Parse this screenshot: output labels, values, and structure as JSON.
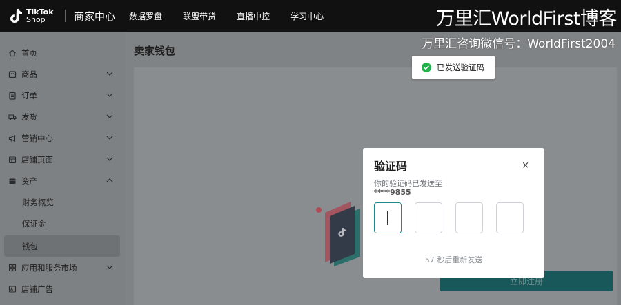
{
  "topbar": {
    "logo_line1": "TikTok",
    "logo_line2": "Shop",
    "brand": "商家中心",
    "nav": [
      "数据罗盘",
      "联盟带货",
      "直播中控",
      "学习中心"
    ]
  },
  "watermark": {
    "line1": "万里汇WorldFirst博客",
    "line2": "万里汇咨询微信号：WorldFirst2004"
  },
  "sidebar": {
    "items": [
      {
        "label": "首页",
        "icon": "home-icon"
      },
      {
        "label": "商品",
        "icon": "product-icon"
      },
      {
        "label": "订单",
        "icon": "order-icon"
      },
      {
        "label": "发货",
        "icon": "truck-icon"
      },
      {
        "label": "营销中心",
        "icon": "megaphone-icon"
      },
      {
        "label": "店铺页面",
        "icon": "store-icon"
      },
      {
        "label": "资产",
        "icon": "wallet-icon"
      }
    ],
    "sub_items": [
      "财务概览",
      "保证金",
      "钱包"
    ],
    "bottom_items": [
      {
        "label": "应用和服务市场",
        "icon": "apps-icon"
      },
      {
        "label": "店铺广告",
        "icon": "ads-icon"
      }
    ]
  },
  "main": {
    "page_title": "卖家钱包",
    "register_button": "立即注册"
  },
  "toast": {
    "message": "已发送验证码",
    "color": "#22b04b"
  },
  "modal": {
    "title": "验证码",
    "close": "×",
    "description": "你的验证码已发送至",
    "phone": "****9855",
    "countdown": "57 秒后重新发送",
    "accent_color": "#1a8c8e"
  }
}
